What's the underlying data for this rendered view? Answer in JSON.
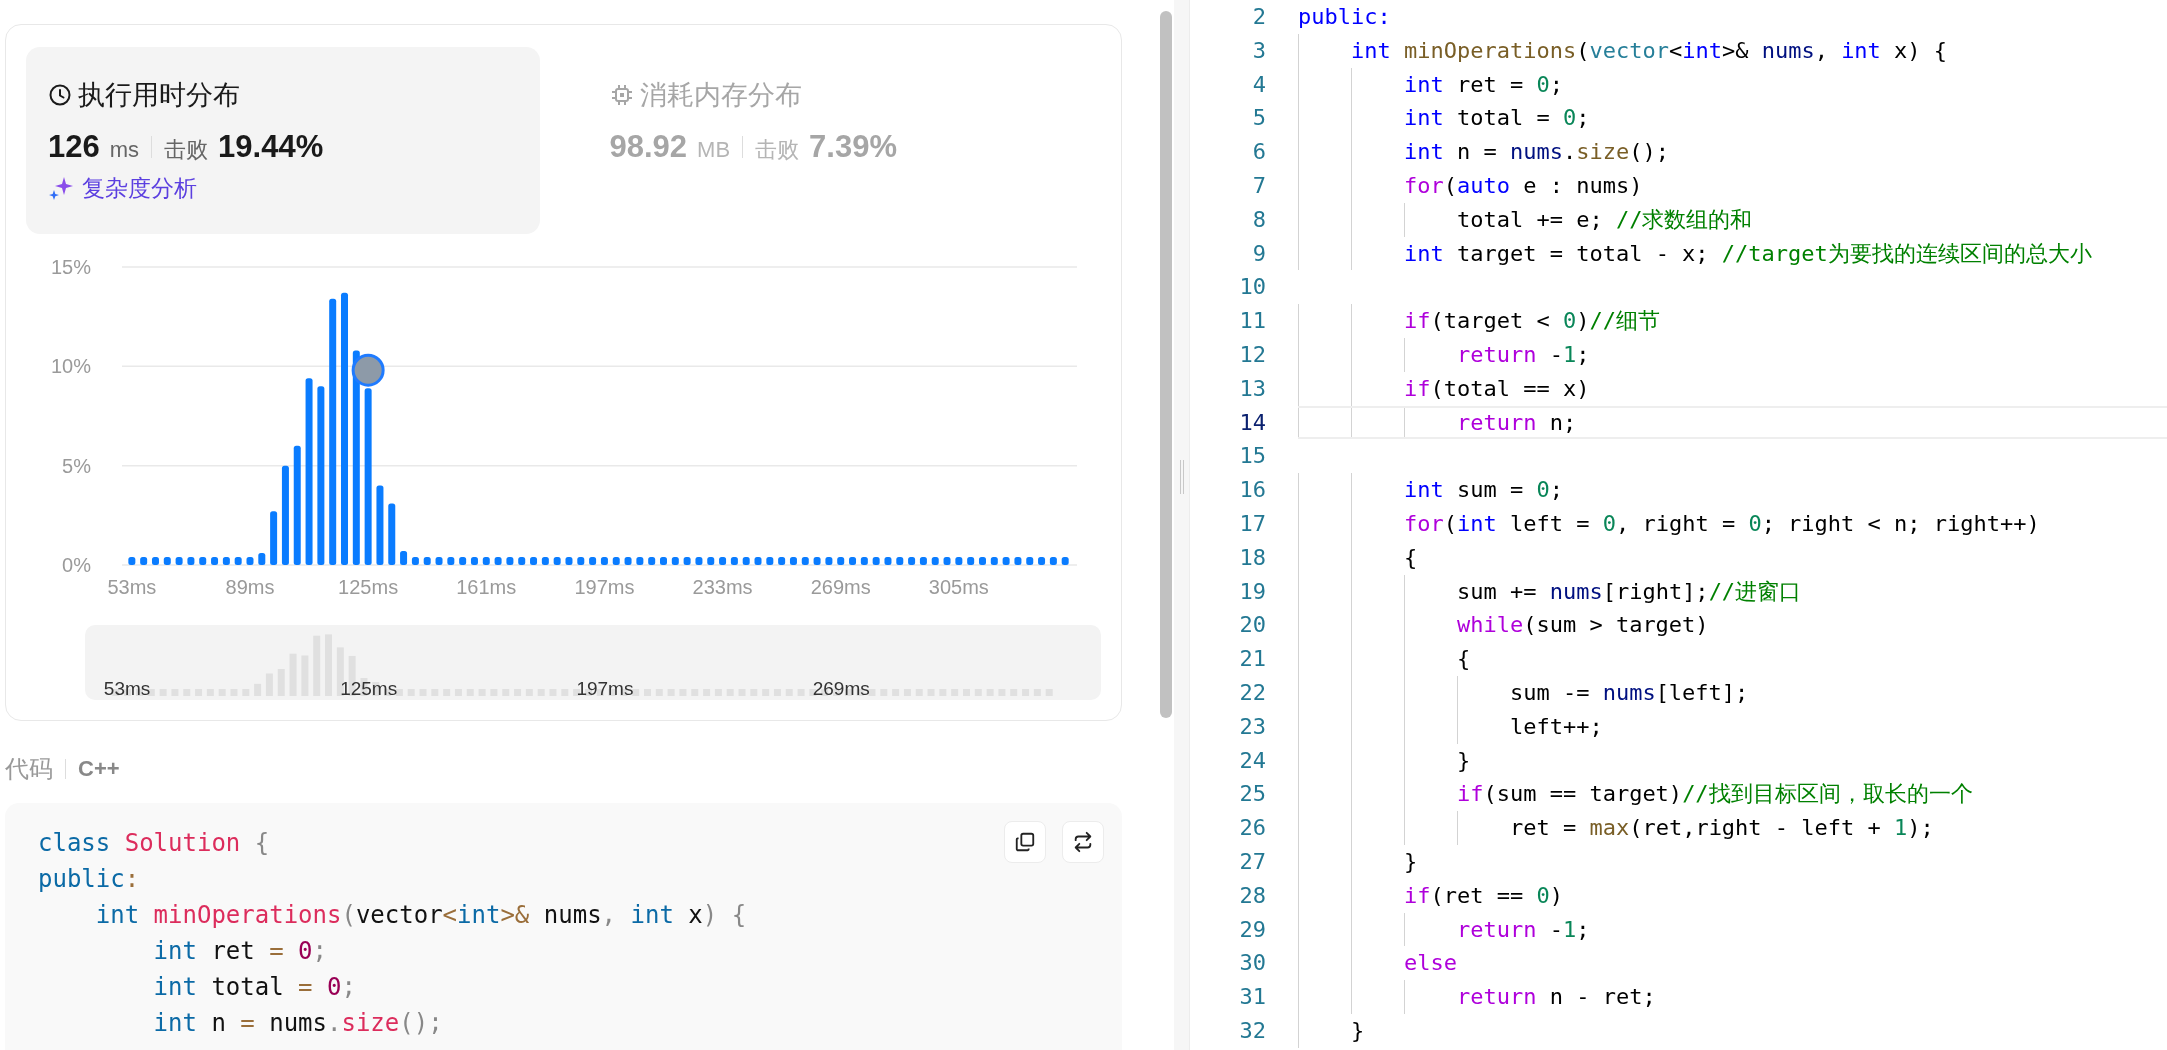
{
  "stats_tabs": [
    {
      "kind": "time",
      "title": "执行用时分布",
      "value": "126",
      "unit": "ms",
      "beat_label": "击败",
      "beat": "19.44%",
      "link": "复杂度分析",
      "selected": true
    },
    {
      "kind": "memory",
      "title": "消耗内存分布",
      "value": "98.92",
      "unit": "MB",
      "beat_label": "击败",
      "beat": "7.39%",
      "selected": false
    }
  ],
  "runtime_chart": {
    "chart_data": {
      "type": "bar",
      "x": [
        53,
        56.6,
        60.2,
        63.8,
        67.4,
        71,
        74.6,
        78.2,
        81.8,
        85.4,
        89,
        92.6,
        96.2,
        99.8,
        103.4,
        107,
        110.6,
        114.2,
        117.8,
        121.4,
        125,
        128.6,
        132.2,
        135.8,
        139.4,
        143,
        146.6,
        150.2,
        153.8,
        157.4,
        161,
        164.6,
        168.2,
        171.8,
        175.4,
        179,
        182.6,
        186.2,
        189.8,
        193.4,
        197,
        200.6,
        204.2,
        207.8,
        211.4,
        215,
        218.6,
        222.2,
        225.8,
        229.4,
        233,
        236.6,
        240.2,
        243.8,
        247.4,
        251,
        254.6,
        258.2,
        261.8,
        265.4,
        269,
        272.6,
        276.2,
        279.8,
        283.4,
        287,
        290.6,
        294.2,
        297.8,
        301.4,
        305,
        308.6,
        312.2,
        315.8,
        319.4,
        323,
        326.6,
        330.2,
        333.8,
        337.4
      ],
      "values": [
        0.4,
        0.4,
        0.4,
        0.4,
        0.4,
        0.4,
        0.4,
        0.4,
        0.4,
        0.4,
        0.4,
        0.6,
        2.7,
        5.0,
        6.0,
        9.4,
        9.0,
        13.4,
        13.7,
        10.8,
        8.9,
        4.0,
        3.1,
        0.7,
        0.4,
        0.4,
        0.4,
        0.4,
        0.4,
        0.4,
        0.4,
        0.4,
        0.4,
        0.4,
        0.4,
        0.4,
        0.4,
        0.4,
        0.4,
        0.4,
        0.4,
        0.4,
        0.4,
        0.4,
        0.4,
        0.4,
        0.4,
        0.4,
        0.4,
        0.4,
        0.4,
        0.4,
        0.4,
        0.4,
        0.4,
        0.4,
        0.4,
        0.4,
        0.4,
        0.4,
        0.4,
        0.4,
        0.4,
        0.4,
        0.4,
        0.4,
        0.4,
        0.4,
        0.4,
        0.4,
        0.4,
        0.4,
        0.4,
        0.4,
        0.4,
        0.4,
        0.4,
        0.4,
        0.4,
        0.4
      ],
      "xlim": [
        50,
        341
      ],
      "ylim": [
        0,
        15
      ],
      "yticks": [
        {
          "value": 0,
          "label": "0%"
        },
        {
          "value": 5,
          "label": "5%"
        },
        {
          "value": 10,
          "label": "10%"
        },
        {
          "value": 15,
          "label": "15%"
        }
      ],
      "xticks": [
        {
          "value": 53,
          "label": "53ms"
        },
        {
          "value": 89,
          "label": "89ms"
        },
        {
          "value": 125,
          "label": "125ms"
        },
        {
          "value": 161,
          "label": "161ms"
        },
        {
          "value": 197,
          "label": "197ms"
        },
        {
          "value": 233,
          "label": "233ms"
        },
        {
          "value": 269,
          "label": "269ms"
        },
        {
          "value": 305,
          "label": "305ms"
        }
      ]
    },
    "overview_labels": [
      "53ms",
      "125ms",
      "197ms",
      "269ms"
    ]
  },
  "code_header": {
    "label": "代码",
    "language": "C++"
  },
  "code_block": {
    "lines": [
      [
        {
          "text": "class",
          "kind": "kw"
        },
        {
          "text": " Solution",
          "kind": "ent"
        },
        {
          "text": " {",
          "kind": "pu"
        }
      ],
      [
        {
          "text": "public",
          "kind": "kw"
        },
        {
          "text": ":",
          "kind": "op"
        }
      ],
      [
        {
          "text": "    int",
          "kind": "kw"
        },
        {
          "text": " minOperations",
          "kind": "ent"
        },
        {
          "text": "(",
          "kind": "pu"
        },
        {
          "text": "vector",
          "kind": "p"
        },
        {
          "text": "<",
          "kind": "op"
        },
        {
          "text": "int",
          "kind": "kw"
        },
        {
          "text": ">&",
          "kind": "op"
        },
        {
          "text": " nums",
          "kind": "p"
        },
        {
          "text": ",",
          "kind": "pu"
        },
        {
          "text": " int",
          "kind": "kw"
        },
        {
          "text": " x",
          "kind": "p"
        },
        {
          "text": ")",
          "kind": "pu"
        },
        {
          "text": " {",
          "kind": "pu"
        }
      ],
      [
        {
          "text": "        int",
          "kind": "kw"
        },
        {
          "text": " ret ",
          "kind": "p"
        },
        {
          "text": "=",
          "kind": "op"
        },
        {
          "text": " 0",
          "kind": "num"
        },
        {
          "text": ";",
          "kind": "pu"
        }
      ],
      [
        {
          "text": "        int",
          "kind": "kw"
        },
        {
          "text": " total ",
          "kind": "p"
        },
        {
          "text": "=",
          "kind": "op"
        },
        {
          "text": " 0",
          "kind": "num"
        },
        {
          "text": ";",
          "kind": "pu"
        }
      ],
      [
        {
          "text": "        int",
          "kind": "kw"
        },
        {
          "text": " n ",
          "kind": "p"
        },
        {
          "text": "=",
          "kind": "op"
        },
        {
          "text": " nums",
          "kind": "p"
        },
        {
          "text": ".",
          "kind": "pu"
        },
        {
          "text": "size",
          "kind": "ent"
        },
        {
          "text": "();",
          "kind": "pu"
        }
      ]
    ]
  },
  "editor": {
    "lines": [
      {
        "number": "2",
        "current": false,
        "tokens": [
          {
            "text": "public:",
            "kind": "kw"
          }
        ]
      },
      {
        "number": "3",
        "current": false,
        "tokens": [
          {
            "text": "    int",
            "kind": "kw"
          },
          {
            "text": " minOperations",
            "kind": "fn"
          },
          {
            "text": "(",
            "kind": "p"
          },
          {
            "text": "vector",
            "kind": "ty"
          },
          {
            "text": "<",
            "kind": "p"
          },
          {
            "text": "int",
            "kind": "kw"
          },
          {
            "text": ">& ",
            "kind": "p"
          },
          {
            "text": "nums",
            "kind": "var"
          },
          {
            "text": ", ",
            "kind": "p"
          },
          {
            "text": "int",
            "kind": "kw"
          },
          {
            "text": " x) {",
            "kind": "p"
          }
        ]
      },
      {
        "number": "4",
        "current": false,
        "tokens": [
          {
            "text": "        int",
            "kind": "kw"
          },
          {
            "text": " ret = ",
            "kind": "p"
          },
          {
            "text": "0",
            "kind": "num"
          },
          {
            "text": ";",
            "kind": "p"
          }
        ]
      },
      {
        "number": "5",
        "current": false,
        "tokens": [
          {
            "text": "        int",
            "kind": "kw"
          },
          {
            "text": " total = ",
            "kind": "p"
          },
          {
            "text": "0",
            "kind": "num"
          },
          {
            "text": ";",
            "kind": "p"
          }
        ]
      },
      {
        "number": "6",
        "current": false,
        "tokens": [
          {
            "text": "        int",
            "kind": "kw"
          },
          {
            "text": " n = ",
            "kind": "p"
          },
          {
            "text": "nums",
            "kind": "var"
          },
          {
            "text": ".",
            "kind": "p"
          },
          {
            "text": "size",
            "kind": "fn"
          },
          {
            "text": "();",
            "kind": "p"
          }
        ]
      },
      {
        "number": "7",
        "current": false,
        "tokens": [
          {
            "text": "        for",
            "kind": "ctl"
          },
          {
            "text": "(",
            "kind": "p"
          },
          {
            "text": "auto",
            "kind": "kw"
          },
          {
            "text": " e : nums)",
            "kind": "p"
          }
        ]
      },
      {
        "number": "8",
        "current": false,
        "tokens": [
          {
            "text": "            total += e; ",
            "kind": "p"
          },
          {
            "text": "//求数组的和",
            "kind": "cm"
          }
        ]
      },
      {
        "number": "9",
        "current": false,
        "tokens": [
          {
            "text": "        int",
            "kind": "kw"
          },
          {
            "text": " target = total - x; ",
            "kind": "p"
          },
          {
            "text": "//target为要找的连续区间的总大小",
            "kind": "cm"
          }
        ]
      },
      {
        "number": "10",
        "current": false
      },
      {
        "number": "11",
        "current": false,
        "tokens": [
          {
            "text": "        if",
            "kind": "ctl"
          },
          {
            "text": "(target < ",
            "kind": "p"
          },
          {
            "text": "0",
            "kind": "num"
          },
          {
            "text": ")",
            "kind": "p"
          },
          {
            "text": "//细节",
            "kind": "cm"
          }
        ]
      },
      {
        "number": "12",
        "current": false,
        "tokens": [
          {
            "text": "            return",
            "kind": "ctl"
          },
          {
            "text": " -",
            "kind": "p"
          },
          {
            "text": "1",
            "kind": "num"
          },
          {
            "text": ";",
            "kind": "p"
          }
        ]
      },
      {
        "number": "13",
        "current": false,
        "tokens": [
          {
            "text": "        if",
            "kind": "ctl"
          },
          {
            "text": "(total == x)",
            "kind": "p"
          }
        ]
      },
      {
        "number": "14",
        "current": true,
        "tokens": [
          {
            "text": "            return",
            "kind": "ctl"
          },
          {
            "text": " n;",
            "kind": "p"
          }
        ]
      },
      {
        "number": "15",
        "current": false
      },
      {
        "number": "16",
        "current": false,
        "tokens": [
          {
            "text": "        int",
            "kind": "kw"
          },
          {
            "text": " sum = ",
            "kind": "p"
          },
          {
            "text": "0",
            "kind": "num"
          },
          {
            "text": ";",
            "kind": "p"
          }
        ]
      },
      {
        "number": "17",
        "current": false,
        "tokens": [
          {
            "text": "        for",
            "kind": "ctl"
          },
          {
            "text": "(",
            "kind": "p"
          },
          {
            "text": "int",
            "kind": "kw"
          },
          {
            "text": " left = ",
            "kind": "p"
          },
          {
            "text": "0",
            "kind": "num"
          },
          {
            "text": ", right = ",
            "kind": "p"
          },
          {
            "text": "0",
            "kind": "num"
          },
          {
            "text": "; right < n; right++)",
            "kind": "p"
          }
        ]
      },
      {
        "number": "18",
        "current": false,
        "tokens": [
          {
            "text": "        {",
            "kind": "p"
          }
        ]
      },
      {
        "number": "19",
        "current": false,
        "tokens": [
          {
            "text": "            sum += ",
            "kind": "p"
          },
          {
            "text": "nums",
            "kind": "var"
          },
          {
            "text": "[right];",
            "kind": "p"
          },
          {
            "text": "//进窗口",
            "kind": "cm"
          }
        ]
      },
      {
        "number": "20",
        "current": false,
        "tokens": [
          {
            "text": "            while",
            "kind": "ctl"
          },
          {
            "text": "(sum > target)",
            "kind": "p"
          }
        ]
      },
      {
        "number": "21",
        "current": false,
        "tokens": [
          {
            "text": "            {",
            "kind": "p"
          }
        ]
      },
      {
        "number": "22",
        "current": false,
        "tokens": [
          {
            "text": "                sum -= ",
            "kind": "p"
          },
          {
            "text": "nums",
            "kind": "var"
          },
          {
            "text": "[left];",
            "kind": "p"
          }
        ]
      },
      {
        "number": "23",
        "current": false,
        "tokens": [
          {
            "text": "                left++;",
            "kind": "p"
          }
        ]
      },
      {
        "number": "24",
        "current": false,
        "tokens": [
          {
            "text": "            }",
            "kind": "p"
          }
        ]
      },
      {
        "number": "25",
        "current": false,
        "tokens": [
          {
            "text": "            if",
            "kind": "ctl"
          },
          {
            "text": "(sum == target)",
            "kind": "p"
          },
          {
            "text": "//找到目标区间，取长的一个",
            "kind": "cm"
          }
        ]
      },
      {
        "number": "26",
        "current": false,
        "tokens": [
          {
            "text": "                ret = ",
            "kind": "p"
          },
          {
            "text": "max",
            "kind": "fn"
          },
          {
            "text": "(ret,right - left + ",
            "kind": "p"
          },
          {
            "text": "1",
            "kind": "num"
          },
          {
            "text": ");",
            "kind": "p"
          }
        ]
      },
      {
        "number": "27",
        "current": false,
        "tokens": [
          {
            "text": "        }",
            "kind": "p"
          }
        ]
      },
      {
        "number": "28",
        "current": false,
        "tokens": [
          {
            "text": "        if",
            "kind": "ctl"
          },
          {
            "text": "(ret == ",
            "kind": "p"
          },
          {
            "text": "0",
            "kind": "num"
          },
          {
            "text": ")",
            "kind": "p"
          }
        ]
      },
      {
        "number": "29",
        "current": false,
        "tokens": [
          {
            "text": "            return",
            "kind": "ctl"
          },
          {
            "text": " -",
            "kind": "p"
          },
          {
            "text": "1",
            "kind": "num"
          },
          {
            "text": ";",
            "kind": "p"
          }
        ]
      },
      {
        "number": "30",
        "current": false,
        "tokens": [
          {
            "text": "        else",
            "kind": "ctl"
          }
        ]
      },
      {
        "number": "31",
        "current": false,
        "tokens": [
          {
            "text": "            return",
            "kind": "ctl"
          },
          {
            "text": " n - ret;",
            "kind": "p"
          }
        ]
      },
      {
        "number": "32",
        "current": false,
        "tokens": [
          {
            "text": "    }",
            "kind": "p"
          }
        ]
      }
    ]
  }
}
